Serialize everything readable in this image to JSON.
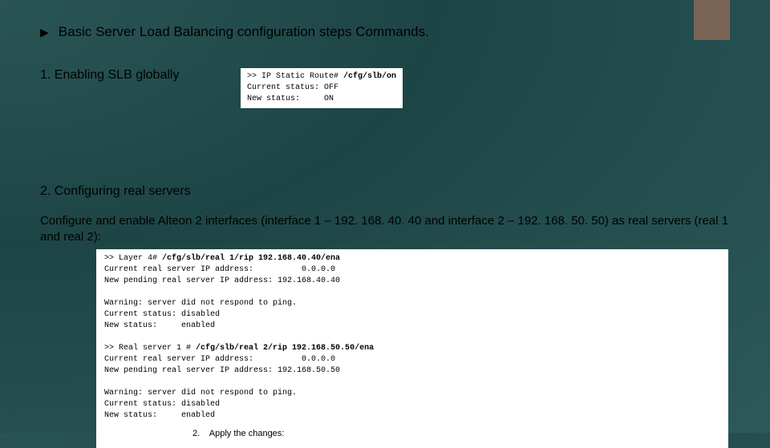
{
  "title": "Basic Server Load Balancing configuration steps Commands.",
  "step1": {
    "label": "1. Enabling SLB globally",
    "code": {
      "line1_prefix": ">> IP Static Route# ",
      "line1_cmd": "/cfg/slb/on",
      "line2": "Current status: OFF",
      "line3": "New status:     ON"
    }
  },
  "step2": {
    "label": "2. Configuring real servers",
    "desc": "Configure and enable Alteon 2 interfaces (interface 1 – 192. 168. 40. 40 and interface 2 – 192. 168. 50. 50) as real servers (real 1 and real 2):",
    "code": {
      "l1_prefix": ">> Layer 4# ",
      "l1_cmd": "/cfg/slb/real 1/rip 192.168.40.40/ena",
      "l2": "Current real server IP address:          0.0.0.0",
      "l3": "New pending real server IP address: 192.168.40.40",
      "l4": "",
      "l5": "Warning: server did not respond to ping.",
      "l6": "Current status: disabled",
      "l7": "New status:     enabled",
      "l8": "",
      "l9_prefix": ">> Real server 1 # ",
      "l9_cmd": "/cfg/slb/real 2/rip 192.168.50.50/ena",
      "l10": "Current real server IP address:          0.0.0.0",
      "l11": "New pending real server IP address: 192.168.50.50",
      "l12": "",
      "l13": "Warning: server did not respond to ping.",
      "l14": "Current status: disabled",
      "l15": "New status:     enabled"
    },
    "apply": "2.    Apply the changes:"
  }
}
